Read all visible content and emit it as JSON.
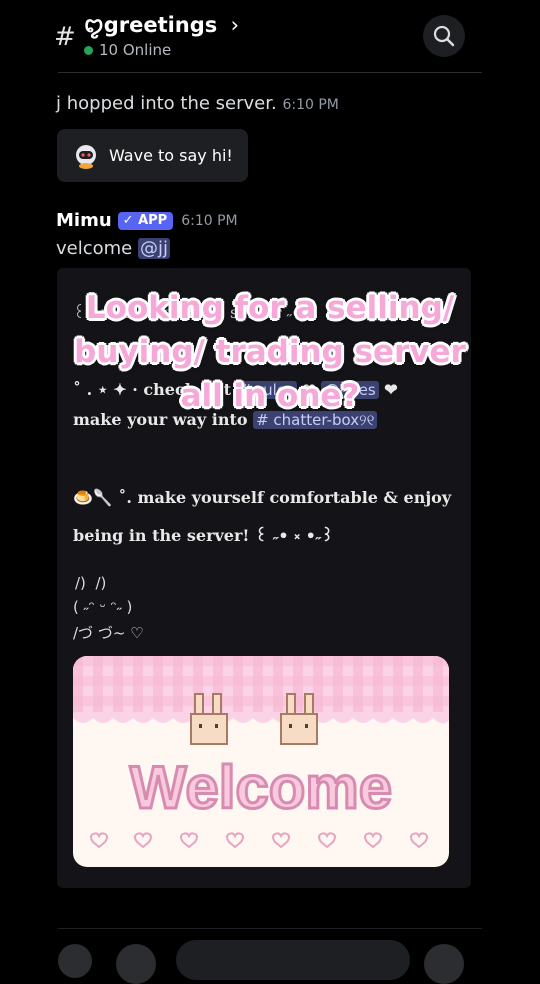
{
  "header": {
    "hash_icon": "#",
    "channel_name": "ꨄgreetings",
    "chevron": "›",
    "online_text": "10 Online",
    "online_color": "#23a55a"
  },
  "join_message": {
    "text": "j hopped into the server.",
    "time": "6:10 PM"
  },
  "wave_button": {
    "label": "Wave to say hi!",
    "icon": "robot-wave-icon"
  },
  "bot_message": {
    "author": "Mimu",
    "badge_check": "✓",
    "badge": "APP",
    "time": "6:10 PM",
    "text_prefix": "velcome",
    "mention": "@jj"
  },
  "embed": {
    "line1": "꒰ ˶ welcome to the server ˶ ꒱",
    "line2_prefix": "˚ . ⋆ ✦ · check out",
    "rules_channel": "# rules",
    "heart1": "❤",
    "roles_channel": "@roles",
    "heart2": "❤",
    "line3_prefix": "make your way into",
    "chatter_channel": "# chatter-box୨୧",
    "line4": "🍮🥄 ˚. make yourself comfortable & enjoy",
    "line5": "being in the server! ꒰ ˶• ༝ •˶꒱",
    "kaomoji_1": "/)  /)",
    "kaomoji_2": "( ˶ᵔ ᵕ ᵔ˶ )",
    "kaomoji_3": "/づ づ~ ♡",
    "banner_text": "Welcome"
  },
  "overlay": {
    "line1": "Looking for a selling/",
    "line2": "buying/ trading server",
    "line3": "all in one?"
  },
  "colors": {
    "background": "#000000",
    "accent": "#5865f2",
    "overlay_pink": "#f6a9d8"
  }
}
